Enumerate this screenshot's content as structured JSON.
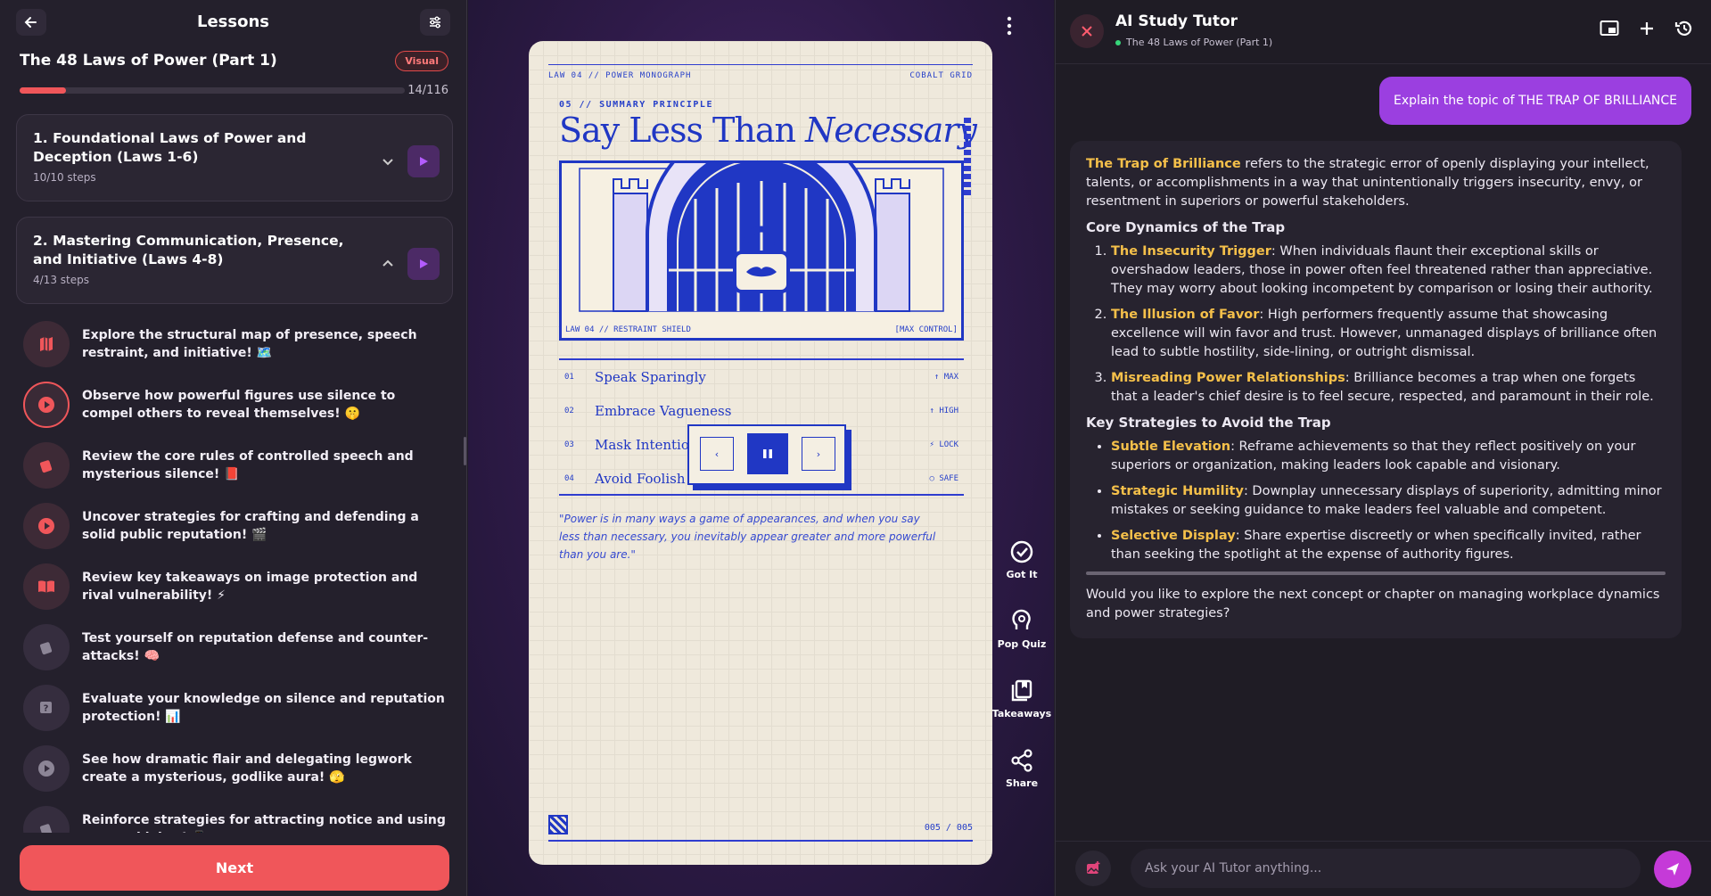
{
  "left": {
    "header_title": "Lessons",
    "course_title": "The 48 Laws of Power (Part 1)",
    "badge": "Visual",
    "progress": {
      "current": 14,
      "total": 116,
      "label": "14/116"
    },
    "chapters": [
      {
        "title": "1. Foundational Laws of Power and Deception (Laws 1-6)",
        "steps": "10/10 steps"
      },
      {
        "title": "2. Mastering Communication, Presence, and Initiative (Laws 4-8)",
        "steps": "4/13 steps"
      }
    ],
    "steps": [
      {
        "text": "Explore the structural map of presence, speech restraint, and initiative! 🗺️",
        "icon": "map-icon"
      },
      {
        "text": "Observe how powerful figures use silence to compel others to reveal themselves! 🤫",
        "icon": "play-icon"
      },
      {
        "text": "Review the core rules of controlled speech and mysterious silence! 📕",
        "icon": "flashcards-icon"
      },
      {
        "text": "Uncover strategies for crafting and defending a solid public reputation! 🎬",
        "icon": "play-icon"
      },
      {
        "text": "Review key takeaways on image protection and rival vulnerability! ⚡",
        "icon": "book-open-icon"
      },
      {
        "text": "Test yourself on reputation defense and counter-attacks! 🧠",
        "icon": "flashcards-icon"
      },
      {
        "text": "Evaluate your knowledge on silence and reputation protection! 📊",
        "icon": "quiz-icon"
      },
      {
        "text": "See how dramatic flair and delegating legwork create a mysterious, godlike aura! 🫣",
        "icon": "play-icon"
      },
      {
        "text": "Reinforce strategies for attracting notice and using external labor! 📱",
        "icon": "flashcards-icon"
      }
    ],
    "next_label": "Next"
  },
  "center": {
    "paper": {
      "top_left": "LAW 04 // POWER MONOGRAPH",
      "top_right": "COBALT GRID",
      "kicker": "05 // SUMMARY PRINCIPLE",
      "headline_plain": "Say Less Than",
      "headline_italic": "Necessary",
      "illus_caption_left": "LAW 04 // RESTRAINT SHIELD",
      "illus_caption_right": "[MAX CONTROL]",
      "rows": [
        {
          "num": "01",
          "text": "Speak Sparingly",
          "status": "↑ MAX"
        },
        {
          "num": "02",
          "text": "Embrace Vagueness",
          "status": "↑ HIGH"
        },
        {
          "num": "03",
          "text": "Mask Intentions",
          "status": "⚡ LOCK"
        },
        {
          "num": "04",
          "text": "Avoid Foolish Statements",
          "status": "○ SAFE"
        }
      ],
      "quote": "\"Power is in many ways a game of appearances, and when you say less than necessary, you inevitably appear greater and more powerful than you are.\"",
      "page": "005 / 005"
    },
    "controls": {
      "prev": "‹",
      "next": "›"
    },
    "rail": [
      {
        "label": "Got It",
        "icon": "check-circle-icon"
      },
      {
        "label": "Pop Quiz",
        "icon": "brain-icon"
      },
      {
        "label": "Takeaways",
        "icon": "takeaways-icon"
      },
      {
        "label": "Share",
        "icon": "share-icon"
      }
    ]
  },
  "right": {
    "title": "AI Study Tutor",
    "subtitle": "The 48 Laws of Power (Part 1)",
    "user_message": "Explain the topic of THE TRAP OF BRILLIANCE",
    "answer": {
      "intro_hl": "The Trap of Brilliance",
      "intro": " refers to the strategic error of openly displaying your intellect, talents, or accomplishments in a way that unintentionally triggers insecurity, envy, or resentment in superiors or powerful stakeholders.",
      "h1": "Core Dynamics of the Trap",
      "dynamics": [
        {
          "hl": "The Insecurity Trigger",
          "text": ": When individuals flaunt their exceptional skills or overshadow leaders, those in power often feel threatened rather than appreciative. They may worry about looking incompetent by comparison or losing their authority."
        },
        {
          "hl": "The Illusion of Favor",
          "text": ": High performers frequently assume that showcasing excellence will win favor and trust. However, unmanaged displays of brilliance often lead to subtle hostility, side-lining, or outright dismissal."
        },
        {
          "hl": "Misreading Power Relationships",
          "text": ": Brilliance becomes a trap when one forgets that a leader's chief desire is to feel secure, respected, and paramount in their role."
        }
      ],
      "h2": "Key Strategies to Avoid the Trap",
      "strategies": [
        {
          "hl": "Subtle Elevation",
          "text": ": Reframe achievements so that they reflect positively on your superiors or organization, making leaders look capable and visionary."
        },
        {
          "hl": "Strategic Humility",
          "text": ": Downplay unnecessary displays of superiority, admitting minor mistakes or seeking guidance to make leaders feel valuable and competent."
        },
        {
          "hl": "Selective Display",
          "text": ": Share expertise discreetly or when specifically invited, rather than seeking the spotlight at the expense of authority figures."
        }
      ],
      "followup": "Would you like to explore the next concept or chapter on managing workplace dynamics and power strategies?"
    },
    "input_placeholder": "Ask your AI Tutor anything..."
  }
}
